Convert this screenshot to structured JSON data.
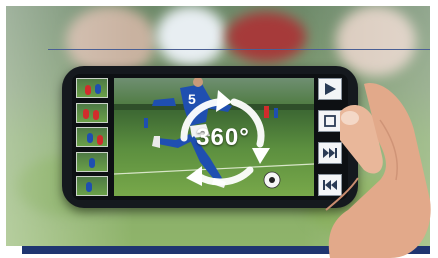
{
  "overlay": {
    "label": "360°"
  },
  "player": {
    "jersey_number": "5"
  },
  "controls": [
    {
      "name": "play-button",
      "icon": "play-icon"
    },
    {
      "name": "stop-button",
      "icon": "stop-icon"
    },
    {
      "name": "fast-forward-button",
      "icon": "fast-forward-icon"
    },
    {
      "name": "rewind-button",
      "icon": "rewind-icon"
    }
  ],
  "thumbnails": [
    {
      "name": "thumbnail-1"
    },
    {
      "name": "thumbnail-2"
    },
    {
      "name": "thumbnail-3"
    },
    {
      "name": "thumbnail-4"
    },
    {
      "name": "thumbnail-5"
    }
  ],
  "colors": {
    "frame": "#1f3570",
    "kit_blue": "#1f4fb0",
    "grass": "#6aa048",
    "phone": "#15191e"
  }
}
